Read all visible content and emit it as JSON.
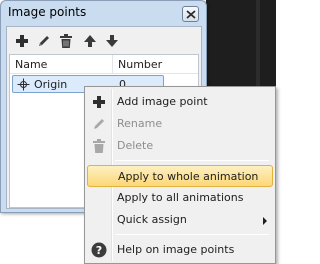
{
  "window": {
    "title": "Image points",
    "close_icon": "close-icon"
  },
  "toolbar": {
    "buttons": [
      {
        "icon": "add-icon",
        "label": "Add image point"
      },
      {
        "icon": "rename-icon",
        "label": "Rename"
      },
      {
        "icon": "delete-icon",
        "label": "Delete"
      },
      {
        "icon": "move-up-icon",
        "label": "Move up"
      },
      {
        "icon": "move-down-icon",
        "label": "Move down"
      }
    ]
  },
  "list": {
    "columns": [
      "Name",
      "Number"
    ],
    "rows": [
      {
        "name": "Origin",
        "number": "0",
        "icon": "origin-point-icon",
        "selected": true
      }
    ]
  },
  "context_menu": {
    "items": [
      {
        "label": "Add image point",
        "icon": "add-icon",
        "enabled": true
      },
      {
        "label": "Rename",
        "icon": "rename-icon",
        "enabled": false
      },
      {
        "label": "Delete",
        "icon": "delete-icon",
        "enabled": false
      },
      {
        "separator": true
      },
      {
        "label": "Apply to whole animation",
        "enabled": true,
        "highlighted": true
      },
      {
        "label": "Apply to all animations",
        "enabled": true
      },
      {
        "label": "Quick assign",
        "enabled": true,
        "submenu": true
      },
      {
        "separator": true
      },
      {
        "label": "Help on image points",
        "icon": "help-icon",
        "enabled": true
      }
    ]
  },
  "colors": {
    "window_frame": "#c9dcf0",
    "selection": "#dcebfc",
    "menu_highlight": "#fbd877"
  }
}
